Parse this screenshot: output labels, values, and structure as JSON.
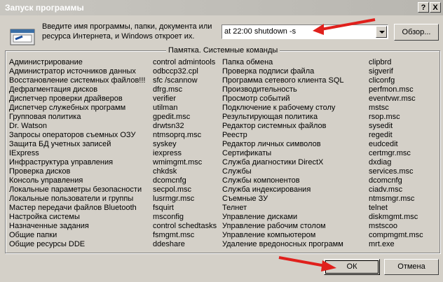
{
  "window": {
    "title": "Запуск программы",
    "help_label": "?",
    "close_label": "X"
  },
  "prompt": {
    "text": "Введите имя программы, папки, документа или ресурса Интернета, и Windows откроет их."
  },
  "command": {
    "value": "at 22:00 shutdown -s"
  },
  "buttons": {
    "browse": "Обзор...",
    "ok": "ОК",
    "cancel": "Отмена"
  },
  "group": {
    "title": "Памятка. Системные команды",
    "col1": [
      "Администрирование",
      "Администратор источников данных",
      "Восстановление системных файлов!!!",
      "Дефрагментация дисков",
      "Диспетчер проверки драйверов",
      "Диспетчер служебных программ",
      "Групповая политика",
      "Dr. Watson",
      "Запросы операторов съемных ОЗУ",
      "Защита БД учетных записей",
      "IExpress",
      "Инфраструктура управления",
      "Проверка дисков",
      "Консоль управления",
      "Локальные параметры безопасности",
      "Локальные пользователи и группы",
      "Мастер передачи файлов Bluetooth",
      "Настройка системы",
      "Назначенные задания",
      "Общие папки",
      "Общие ресурсы DDE"
    ],
    "col2": [
      "control admintools",
      "odbccp32.cpl",
      "sfc /scannow",
      "dfrg.msc",
      "verifier",
      "utilman",
      "gpedit.msc",
      "drwtsn32",
      "ntmsoprq.msc",
      "syskey",
      "iexpress",
      "wmimgmt.msc",
      "chkdsk",
      "dcomcnfg",
      "secpol.msc",
      "lusrmgr.msc",
      "fsquirt",
      "msconfig",
      "control schedtasks",
      "fsmgmt.msc",
      "ddeshare"
    ],
    "col3": [
      "Папка обмена",
      "Проверка подписи файла",
      "Программа сетевого клиента SQL",
      "Производительность",
      "Просмотр событий",
      "Подключение к рабочему столу",
      "Результирующая политика",
      "Редактор системных файлов",
      "Реестр",
      "Редактор личных символов",
      "Сертификаты",
      "Служба диагностики DirectX",
      "Службы",
      "Службы компонентов",
      "Служба индексирования",
      "Съемные ЗУ",
      "Телнет",
      "Управление дисками",
      "Управление рабочим столом",
      "Управление компьютером",
      "Удаление вредоносных программ"
    ],
    "col4": [
      "clipbrd",
      "sigverif",
      "cliconfg",
      "perfmon.msc",
      "eventvwr.msc",
      "mstsc",
      "rsop.msc",
      "sysedit",
      "regedit",
      "eudcedit",
      "certmgr.msc",
      "dxdiag",
      "services.msc",
      "dcomcnfg",
      "ciadv.msc",
      "ntmsmgr.msc",
      "telnet",
      "diskmgmt.msc",
      "mstscoo",
      "compmgmt.msc",
      "mrt.exe"
    ]
  },
  "colors": {
    "face": "#d4d0c8",
    "annotation_arrow": "#e0201c"
  }
}
